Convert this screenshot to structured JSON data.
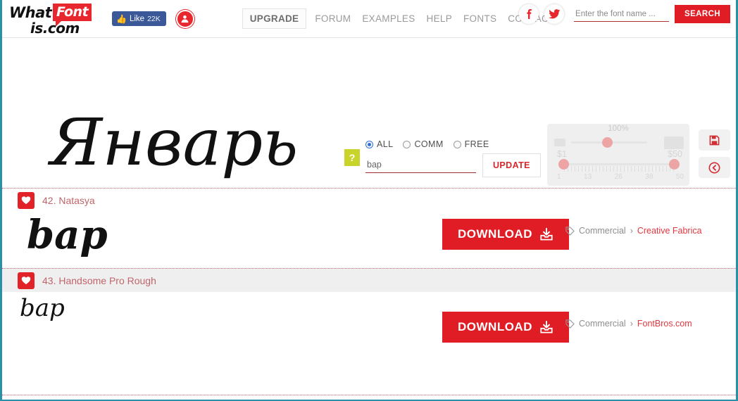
{
  "site": {
    "logo_what": "What",
    "logo_font": "Font",
    "logo_is": "is.com"
  },
  "header": {
    "facebook_like_label": "Like",
    "facebook_like_count": "22K",
    "avatar_icon": "user-circle-icon",
    "nav": [
      {
        "label": "UPGRADE",
        "variant": "button"
      },
      {
        "label": "FORUM",
        "variant": "link"
      },
      {
        "label": "EXAMPLES",
        "variant": "link"
      },
      {
        "label": "HELP",
        "variant": "link"
      },
      {
        "label": "FONTS",
        "variant": "link"
      },
      {
        "label": "CONTACT",
        "variant": "link"
      }
    ],
    "social": [
      {
        "name": "facebook-icon",
        "glyph": "f"
      },
      {
        "name": "twitter-icon",
        "glyph": "t"
      }
    ],
    "search": {
      "placeholder": "Enter the font name ...",
      "value": "",
      "button_label": "SEARCH"
    }
  },
  "preview": {
    "image_text": "Январь",
    "help_badge": "?",
    "filters": {
      "options": [
        {
          "label": "ALL",
          "selected": true
        },
        {
          "label": "COMM",
          "selected": false
        },
        {
          "label": "FREE",
          "selected": false
        }
      ],
      "text_value": "bap",
      "update_label": "UPDATE"
    },
    "slider_panel": {
      "zoom_label": "100%",
      "price_min_label": "$1",
      "price_max_label": "$50",
      "scale_ticks": [
        "1",
        "13",
        "26",
        "38",
        "50"
      ],
      "disabled": true
    },
    "side_actions": [
      {
        "name": "save-icon",
        "title": "save"
      },
      {
        "name": "back-arrow-icon",
        "title": "back"
      }
    ]
  },
  "colors": {
    "brand_red": "#e01c24",
    "accent_green": "#c9d42a",
    "window_border": "#2a8fa8",
    "link_red": "#e0383f",
    "muted_text": "#8e8e8e"
  },
  "results": [
    {
      "index": "42.",
      "name": "42. Natasya",
      "sample_text": "bap",
      "hovered": false,
      "download_label": "DOWNLOAD",
      "license_type": "Commercial",
      "license_separator": "›",
      "license_vendor": "Creative Fabrica"
    },
    {
      "index": "43.",
      "name": "43. Handsome Pro Rough",
      "sample_text": "bap",
      "hovered": true,
      "download_label": "DOWNLOAD",
      "license_type": "Commercial",
      "license_separator": "›",
      "license_vendor": "FontBros.com"
    }
  ]
}
